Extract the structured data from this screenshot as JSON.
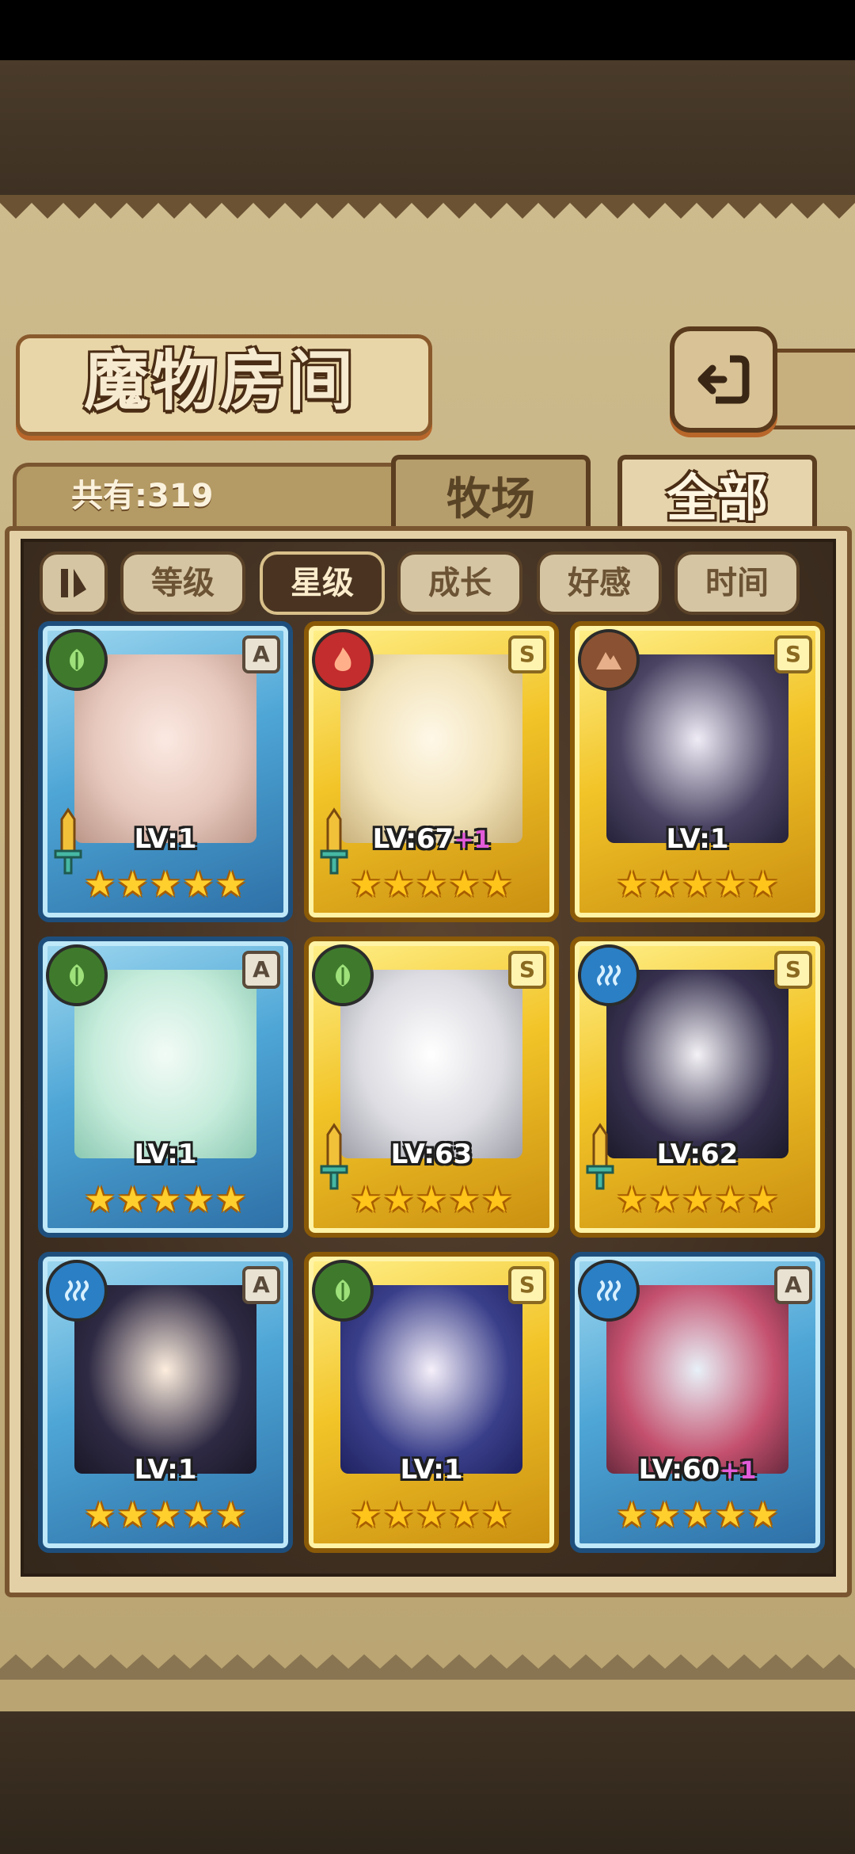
{
  "screen": {
    "title": "魔物房间",
    "count_label": "共有:319",
    "back_icon": "return-arrow-icon"
  },
  "tabs": [
    {
      "label": "牧场",
      "active": false
    },
    {
      "label": "全部",
      "active": true
    }
  ],
  "sort_buttons": [
    {
      "label": "等级",
      "active": false
    },
    {
      "label": "星级",
      "active": true
    },
    {
      "label": "成长",
      "active": false
    },
    {
      "label": "好感",
      "active": false
    },
    {
      "label": "时间",
      "active": false
    }
  ],
  "colors": {
    "parchment": "#c8b484",
    "frame_blue": "#4ea6d6",
    "frame_gold": "#f2c428",
    "active_sort": "#4a3421",
    "star": "#ffc51a",
    "plus_level": "#e25bd8"
  },
  "cards": [
    {
      "element": "leaf-icon",
      "rank": "A",
      "frame": "blue",
      "level": "LV:1",
      "bonus": "",
      "stars": 5,
      "sword": true
    },
    {
      "element": "fire-icon",
      "rank": "S",
      "frame": "gold",
      "level": "LV:67",
      "bonus": "+1",
      "stars": 5,
      "sword": true
    },
    {
      "element": "earth-icon",
      "rank": "S",
      "frame": "gold",
      "level": "LV:1",
      "bonus": "",
      "stars": 5,
      "sword": false
    },
    {
      "element": "leaf-icon",
      "rank": "A",
      "frame": "blue",
      "level": "LV:1",
      "bonus": "",
      "stars": 5,
      "sword": false
    },
    {
      "element": "leaf-icon",
      "rank": "S",
      "frame": "gold",
      "level": "LV:63",
      "bonus": "",
      "stars": 5,
      "sword": true
    },
    {
      "element": "water-icon",
      "rank": "S",
      "frame": "gold",
      "level": "LV:62",
      "bonus": "",
      "stars": 5,
      "sword": true
    },
    {
      "element": "water-icon",
      "rank": "A",
      "frame": "blue",
      "level": "LV:1",
      "bonus": "",
      "stars": 5,
      "sword": false
    },
    {
      "element": "leaf-icon",
      "rank": "S",
      "frame": "gold",
      "level": "LV:1",
      "bonus": "",
      "stars": 5,
      "sword": false
    },
    {
      "element": "water-icon",
      "rank": "A",
      "frame": "blue",
      "level": "LV:60",
      "bonus": "+1",
      "stars": 5,
      "sword": false
    }
  ]
}
